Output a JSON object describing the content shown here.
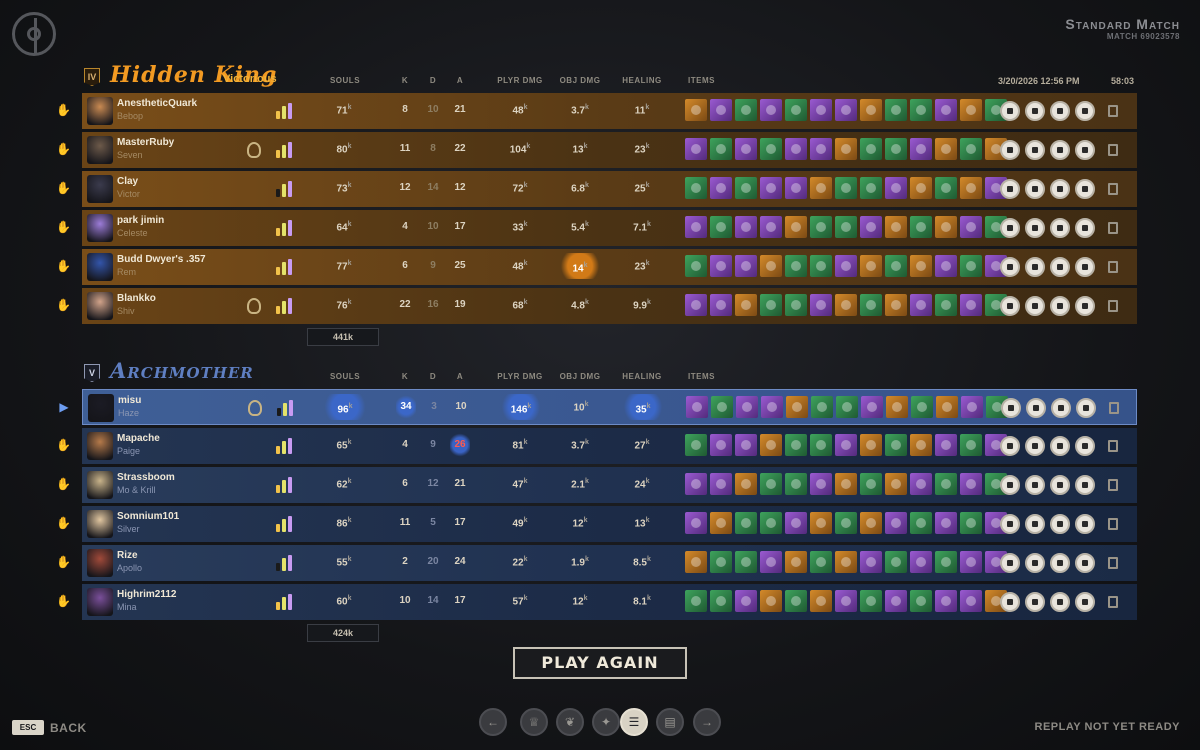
{
  "match": {
    "title": "Standard Match",
    "id": "MATCH 69023578"
  },
  "columns": {
    "souls": "SOULS",
    "k": "K",
    "d": "D",
    "a": "A",
    "plyr_dmg": "PLYR DMG",
    "obj_dmg": "OBJ DMG",
    "healing": "HEALING",
    "items": "ITEMS"
  },
  "teams": [
    {
      "rank": "IV",
      "name": "Hidden King",
      "result": "Victorious",
      "date_time": "3/20/2026 12:56 PM",
      "duration": "58:03",
      "total_souls": "441k",
      "players": [
        {
          "name": "AnestheticQuark",
          "hero": "Bebop",
          "souls": "71",
          "k": "8",
          "d": "10",
          "a": "21",
          "plyr_dmg": "48",
          "obj_dmg": "3.7",
          "healing": "11"
        },
        {
          "name": "MasterRuby",
          "hero": "Seven",
          "souls": "80",
          "k": "11",
          "d": "8",
          "a": "22",
          "plyr_dmg": "104",
          "obj_dmg": "13",
          "healing": "23"
        },
        {
          "name": "Clay",
          "hero": "Victor",
          "souls": "73",
          "k": "12",
          "d": "14",
          "a": "12",
          "plyr_dmg": "72",
          "obj_dmg": "6.8",
          "healing": "25"
        },
        {
          "name": "park jimin",
          "hero": "Celeste",
          "souls": "64",
          "k": "4",
          "d": "10",
          "a": "17",
          "plyr_dmg": "33",
          "obj_dmg": "5.4",
          "healing": "7.1"
        },
        {
          "name": "Budd Dwyer's .357",
          "hero": "Rem",
          "souls": "77",
          "k": "6",
          "d": "9",
          "a": "25",
          "plyr_dmg": "48",
          "obj_dmg": "14",
          "healing": "23"
        },
        {
          "name": "Blankko",
          "hero": "Shiv",
          "souls": "76",
          "k": "22",
          "d": "16",
          "a": "19",
          "plyr_dmg": "68",
          "obj_dmg": "4.8",
          "healing": "9.9"
        }
      ]
    },
    {
      "rank": "V",
      "name": "Archmother",
      "total_souls": "424k",
      "players": [
        {
          "name": "misu",
          "hero": "Haze",
          "souls": "96",
          "k": "34",
          "d": "3",
          "a": "10",
          "plyr_dmg": "146",
          "obj_dmg": "10",
          "healing": "35"
        },
        {
          "name": "Mapache",
          "hero": "Paige",
          "souls": "65",
          "k": "4",
          "d": "9",
          "a": "26",
          "plyr_dmg": "81",
          "obj_dmg": "3.7",
          "healing": "27"
        },
        {
          "name": "Strassboom",
          "hero": "Mo & Krill",
          "souls": "62",
          "k": "6",
          "d": "12",
          "a": "21",
          "plyr_dmg": "47",
          "obj_dmg": "2.1",
          "healing": "24"
        },
        {
          "name": "Somnium101",
          "hero": "Silver",
          "souls": "86",
          "k": "11",
          "d": "5",
          "a": "17",
          "plyr_dmg": "49",
          "obj_dmg": "12",
          "healing": "13"
        },
        {
          "name": "Rize",
          "hero": "Apollo",
          "souls": "55",
          "k": "2",
          "d": "20",
          "a": "24",
          "plyr_dmg": "22",
          "obj_dmg": "1.9",
          "healing": "8.5"
        },
        {
          "name": "Highrim2112",
          "hero": "Mina",
          "souls": "60",
          "k": "10",
          "d": "14",
          "a": "17",
          "plyr_dmg": "57",
          "obj_dmg": "12",
          "healing": "8.1"
        }
      ]
    }
  ],
  "unit": "k",
  "play_again": "PLAY AGAIN",
  "footer": {
    "esc": "ESC",
    "back": "BACK",
    "replay": "REPLAY NOT YET READY"
  },
  "colors": {
    "amber_team": "#f29a22",
    "blue_team": "#5f7fc2",
    "highlight_blue": "#3b67c8",
    "highlight_orange": "#d27a17"
  }
}
